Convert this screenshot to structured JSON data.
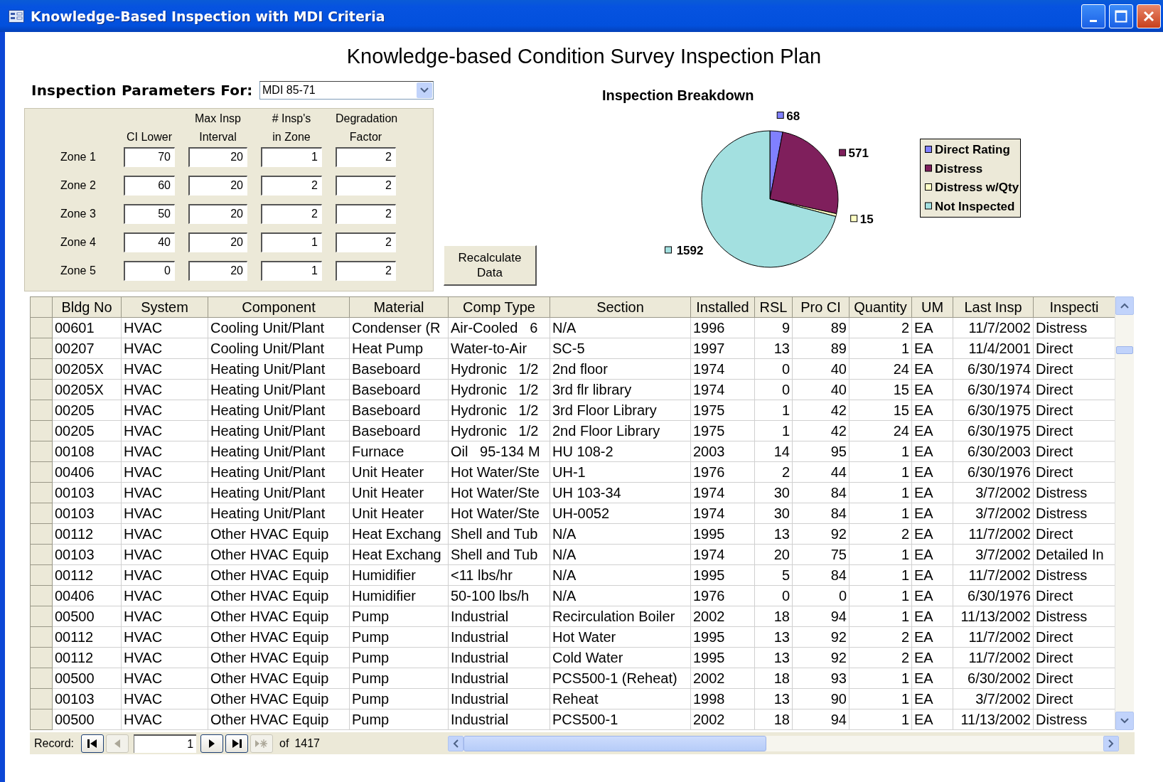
{
  "window": {
    "title": "Knowledge-Based Inspection with MDI Criteria"
  },
  "heading": "Knowledge-based Condition Survey Inspection Plan",
  "parameters": {
    "label": "Inspection Parameters For:",
    "value": "MDI 85-71",
    "column_headers": [
      "CI Lower",
      "Max Insp\nInterval",
      "# Insp's\nin Zone",
      "Degradation\nFactor"
    ],
    "zones": [
      {
        "label": "Zone 1",
        "values": [
          "70",
          "20",
          "1",
          "2"
        ]
      },
      {
        "label": "Zone 2",
        "values": [
          "60",
          "20",
          "2",
          "2"
        ]
      },
      {
        "label": "Zone 3",
        "values": [
          "50",
          "20",
          "2",
          "2"
        ]
      },
      {
        "label": "Zone 4",
        "values": [
          "40",
          "20",
          "1",
          "2"
        ]
      },
      {
        "label": "Zone 5",
        "values": [
          "0",
          "20",
          "1",
          "2"
        ]
      }
    ]
  },
  "recalculate_button": "Recalculate Data",
  "chart": {
    "chart_data": {
      "type": "pie",
      "title": "Inspection Breakdown",
      "categories": [
        "Direct Rating",
        "Distress",
        "Distress w/Qty",
        "Not Inspected"
      ],
      "values": [
        68,
        571,
        15,
        1592
      ],
      "data_labels": true,
      "legend": true
    },
    "slices": [
      {
        "color": "#8080ff"
      },
      {
        "color": "#7f1f5c"
      },
      {
        "color": "#ffffc4"
      },
      {
        "color": "#a3e0e0"
      }
    ]
  },
  "table": {
    "columns": [
      "Bldg No",
      "System",
      "Component",
      "Material",
      "Comp Type",
      "Section",
      "Installed",
      "RSL",
      "Pro CI",
      "Quantity",
      "UM",
      "Last Insp",
      "Inspecti"
    ],
    "rows": [
      [
        "00601",
        "HVAC",
        "Cooling Unit/Plant",
        "Condenser (R",
        "Air-Cooled   6",
        "N/A",
        "1996",
        "9",
        "89",
        "2",
        "EA",
        "11/7/2002",
        "Distress"
      ],
      [
        "00207",
        "HVAC",
        "Cooling Unit/Plant",
        "Heat Pump",
        "Water-to-Air",
        "SC-5",
        "1997",
        "13",
        "89",
        "1",
        "EA",
        "11/4/2001",
        "Direct"
      ],
      [
        "00205X",
        "HVAC",
        "Heating Unit/Plant",
        "Baseboard",
        "Hydronic   1/2",
        "2nd floor",
        "1974",
        "0",
        "40",
        "24",
        "EA",
        "6/30/1974",
        "Direct"
      ],
      [
        "00205X",
        "HVAC",
        "Heating Unit/Plant",
        "Baseboard",
        "Hydronic   1/2",
        "3rd flr library",
        "1974",
        "0",
        "40",
        "15",
        "EA",
        "6/30/1974",
        "Direct"
      ],
      [
        "00205",
        "HVAC",
        "Heating Unit/Plant",
        "Baseboard",
        "Hydronic   1/2",
        "3rd Floor Library",
        "1975",
        "1",
        "42",
        "15",
        "EA",
        "6/30/1975",
        "Direct"
      ],
      [
        "00205",
        "HVAC",
        "Heating Unit/Plant",
        "Baseboard",
        "Hydronic   1/2",
        "2nd Floor Library",
        "1975",
        "1",
        "42",
        "24",
        "EA",
        "6/30/1975",
        "Direct"
      ],
      [
        "00108",
        "HVAC",
        "Heating Unit/Plant",
        "Furnace",
        "Oil   95-134 M",
        "HU 108-2",
        "2003",
        "14",
        "95",
        "1",
        "EA",
        "6/30/2003",
        "Direct"
      ],
      [
        "00406",
        "HVAC",
        "Heating Unit/Plant",
        "Unit Heater",
        "Hot Water/Ste",
        "UH-1",
        "1976",
        "2",
        "44",
        "1",
        "EA",
        "6/30/1976",
        "Direct"
      ],
      [
        "00103",
        "HVAC",
        "Heating Unit/Plant",
        "Unit Heater",
        "Hot Water/Ste",
        "UH 103-34",
        "1974",
        "30",
        "84",
        "1",
        "EA",
        "3/7/2002",
        "Distress"
      ],
      [
        "00103",
        "HVAC",
        "Heating Unit/Plant",
        "Unit Heater",
        "Hot Water/Ste",
        "UH-0052",
        "1974",
        "30",
        "84",
        "1",
        "EA",
        "3/7/2002",
        "Distress"
      ],
      [
        "00112",
        "HVAC",
        "Other HVAC Equip",
        "Heat Exchang",
        "Shell and Tub",
        "N/A",
        "1995",
        "13",
        "92",
        "2",
        "EA",
        "11/7/2002",
        "Direct"
      ],
      [
        "00103",
        "HVAC",
        "Other HVAC Equip",
        "Heat Exchang",
        "Shell and Tub",
        "N/A",
        "1974",
        "20",
        "75",
        "1",
        "EA",
        "3/7/2002",
        "Detailed In"
      ],
      [
        "00112",
        "HVAC",
        "Other HVAC Equip",
        "Humidifier",
        "<11 lbs/hr",
        "N/A",
        "1995",
        "5",
        "84",
        "1",
        "EA",
        "11/7/2002",
        "Distress"
      ],
      [
        "00406",
        "HVAC",
        "Other HVAC Equip",
        "Humidifier",
        "50-100 lbs/h",
        "N/A",
        "1976",
        "0",
        "0",
        "1",
        "EA",
        "6/30/1976",
        "Direct"
      ],
      [
        "00500",
        "HVAC",
        "Other HVAC Equip",
        "Pump",
        "Industrial",
        "Recirculation Boiler",
        "2002",
        "18",
        "94",
        "1",
        "EA",
        "11/13/2002",
        "Distress"
      ],
      [
        "00112",
        "HVAC",
        "Other HVAC Equip",
        "Pump",
        "Industrial",
        "Hot Water",
        "1995",
        "13",
        "92",
        "2",
        "EA",
        "11/7/2002",
        "Direct"
      ],
      [
        "00112",
        "HVAC",
        "Other HVAC Equip",
        "Pump",
        "Industrial",
        "Cold Water",
        "1995",
        "13",
        "92",
        "2",
        "EA",
        "11/7/2002",
        "Direct"
      ],
      [
        "00500",
        "HVAC",
        "Other HVAC Equip",
        "Pump",
        "Industrial",
        "PCS500-1 (Reheat)",
        "2002",
        "18",
        "93",
        "1",
        "EA",
        "6/30/2002",
        "Direct"
      ],
      [
        "00103",
        "HVAC",
        "Other HVAC Equip",
        "Pump",
        "Industrial",
        "Reheat",
        "1998",
        "13",
        "90",
        "1",
        "EA",
        "3/7/2002",
        "Direct"
      ],
      [
        "00500",
        "HVAC",
        "Other HVAC Equip",
        "Pump",
        "Industrial",
        "PCS500-1",
        "2002",
        "18",
        "94",
        "1",
        "EA",
        "11/13/2002",
        "Distress"
      ]
    ]
  },
  "navigation": {
    "label": "Record:",
    "controls": [
      {
        "kind": "first",
        "disabled": false
      },
      {
        "kind": "previous",
        "disabled": true
      },
      {
        "kind": "field",
        "value": "1"
      },
      {
        "kind": "next",
        "disabled": false
      },
      {
        "kind": "last",
        "disabled": false
      },
      {
        "kind": "new",
        "disabled": true
      }
    ],
    "of": "of",
    "total": "1417"
  }
}
